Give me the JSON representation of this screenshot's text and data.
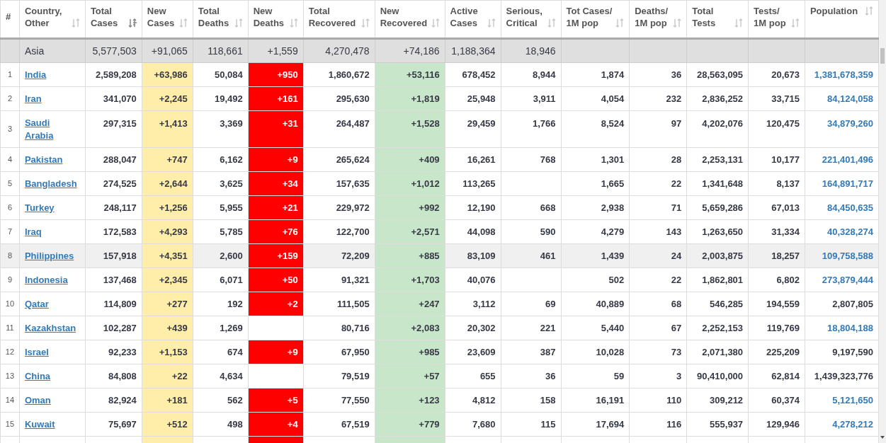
{
  "columns": [
    {
      "label": "#",
      "kind": "index"
    },
    {
      "label": "Country,\nOther",
      "kind": "country",
      "sorted": false
    },
    {
      "label": "Total\nCases",
      "kind": "plain",
      "sorted": true
    },
    {
      "label": "New\nCases",
      "kind": "new_cases",
      "sorted": false
    },
    {
      "label": "Total\nDeaths",
      "kind": "plain",
      "sorted": false
    },
    {
      "label": "New\nDeaths",
      "kind": "new_deaths",
      "sorted": false
    },
    {
      "label": "Total\nRecovered",
      "kind": "plain",
      "sorted": false
    },
    {
      "label": "New\nRecovered",
      "kind": "new_recovered",
      "sorted": false
    },
    {
      "label": "Active\nCases",
      "kind": "plain",
      "sorted": false
    },
    {
      "label": "Serious,\nCritical",
      "kind": "plain",
      "sorted": false
    },
    {
      "label": "Tot Cases/\n1M pop",
      "kind": "plain",
      "sorted": false
    },
    {
      "label": "Deaths/\n1M pop",
      "kind": "plain",
      "sorted": false
    },
    {
      "label": "Total\nTests",
      "kind": "plain",
      "sorted": false
    },
    {
      "label": "Tests/\n1M pop",
      "kind": "plain",
      "sorted": false
    },
    {
      "label": "Population",
      "kind": "population",
      "sorted": false
    }
  ],
  "total_row": {
    "country": "Asia",
    "total_cases": "5,577,503",
    "new_cases": "+91,065",
    "total_deaths": "118,661",
    "new_deaths": "+1,559",
    "total_recovered": "4,270,478",
    "new_recovered": "+74,186",
    "active_cases": "1,188,364",
    "serious_critical": "18,946"
  },
  "rows": [
    {
      "num": "1",
      "country": "India",
      "highlighted": false,
      "population_link": true,
      "total_cases": "2,589,208",
      "new_cases": "+63,986",
      "total_deaths": "50,084",
      "new_deaths": "+950",
      "total_recovered": "1,860,672",
      "new_recovered": "+53,116",
      "active_cases": "678,452",
      "serious_critical": "8,944",
      "cases_per_1m": "1,874",
      "deaths_per_1m": "36",
      "total_tests": "28,563,095",
      "tests_per_1m": "20,673",
      "population": "1,381,678,359"
    },
    {
      "num": "2",
      "country": "Iran",
      "highlighted": false,
      "population_link": true,
      "total_cases": "341,070",
      "new_cases": "+2,245",
      "total_deaths": "19,492",
      "new_deaths": "+161",
      "total_recovered": "295,630",
      "new_recovered": "+1,819",
      "active_cases": "25,948",
      "serious_critical": "3,911",
      "cases_per_1m": "4,054",
      "deaths_per_1m": "232",
      "total_tests": "2,836,252",
      "tests_per_1m": "33,715",
      "population": "84,124,058"
    },
    {
      "num": "3",
      "country": "Saudi Arabia",
      "highlighted": false,
      "population_link": true,
      "total_cases": "297,315",
      "new_cases": "+1,413",
      "total_deaths": "3,369",
      "new_deaths": "+31",
      "total_recovered": "264,487",
      "new_recovered": "+1,528",
      "active_cases": "29,459",
      "serious_critical": "1,766",
      "cases_per_1m": "8,524",
      "deaths_per_1m": "97",
      "total_tests": "4,202,076",
      "tests_per_1m": "120,475",
      "population": "34,879,260"
    },
    {
      "num": "4",
      "country": "Pakistan",
      "highlighted": false,
      "population_link": true,
      "total_cases": "288,047",
      "new_cases": "+747",
      "total_deaths": "6,162",
      "new_deaths": "+9",
      "total_recovered": "265,624",
      "new_recovered": "+409",
      "active_cases": "16,261",
      "serious_critical": "768",
      "cases_per_1m": "1,301",
      "deaths_per_1m": "28",
      "total_tests": "2,253,131",
      "tests_per_1m": "10,177",
      "population": "221,401,496"
    },
    {
      "num": "5",
      "country": "Bangladesh",
      "highlighted": false,
      "population_link": true,
      "total_cases": "274,525",
      "new_cases": "+2,644",
      "total_deaths": "3,625",
      "new_deaths": "+34",
      "total_recovered": "157,635",
      "new_recovered": "+1,012",
      "active_cases": "113,265",
      "cases_per_1m": "1,665",
      "deaths_per_1m": "22",
      "total_tests": "1,341,648",
      "tests_per_1m": "8,137",
      "population": "164,891,717"
    },
    {
      "num": "6",
      "country": "Turkey",
      "highlighted": false,
      "population_link": true,
      "total_cases": "248,117",
      "new_cases": "+1,256",
      "total_deaths": "5,955",
      "new_deaths": "+21",
      "total_recovered": "229,972",
      "new_recovered": "+992",
      "active_cases": "12,190",
      "serious_critical": "668",
      "cases_per_1m": "2,938",
      "deaths_per_1m": "71",
      "total_tests": "5,659,286",
      "tests_per_1m": "67,013",
      "population": "84,450,635"
    },
    {
      "num": "7",
      "country": "Iraq",
      "highlighted": false,
      "population_link": true,
      "total_cases": "172,583",
      "new_cases": "+4,293",
      "total_deaths": "5,785",
      "new_deaths": "+76",
      "total_recovered": "122,700",
      "new_recovered": "+2,571",
      "active_cases": "44,098",
      "serious_critical": "590",
      "cases_per_1m": "4,279",
      "deaths_per_1m": "143",
      "total_tests": "1,263,650",
      "tests_per_1m": "31,334",
      "population": "40,328,274"
    },
    {
      "num": "8",
      "country": "Philippines",
      "highlighted": true,
      "population_link": true,
      "total_cases": "157,918",
      "new_cases": "+4,351",
      "total_deaths": "2,600",
      "new_deaths": "+159",
      "total_recovered": "72,209",
      "new_recovered": "+885",
      "active_cases": "83,109",
      "serious_critical": "461",
      "cases_per_1m": "1,439",
      "deaths_per_1m": "24",
      "total_tests": "2,003,875",
      "tests_per_1m": "18,257",
      "population": "109,758,588"
    },
    {
      "num": "9",
      "country": "Indonesia",
      "highlighted": false,
      "population_link": true,
      "total_cases": "137,468",
      "new_cases": "+2,345",
      "total_deaths": "6,071",
      "new_deaths": "+50",
      "total_recovered": "91,321",
      "new_recovered": "+1,703",
      "active_cases": "40,076",
      "cases_per_1m": "502",
      "deaths_per_1m": "22",
      "total_tests": "1,862,801",
      "tests_per_1m": "6,802",
      "population": "273,879,444"
    },
    {
      "num": "10",
      "country": "Qatar",
      "highlighted": false,
      "population_link": false,
      "total_cases": "114,809",
      "new_cases": "+277",
      "total_deaths": "192",
      "new_deaths": "+2",
      "total_recovered": "111,505",
      "new_recovered": "+247",
      "active_cases": "3,112",
      "serious_critical": "69",
      "cases_per_1m": "40,889",
      "deaths_per_1m": "68",
      "total_tests": "546,285",
      "tests_per_1m": "194,559",
      "population": "2,807,805"
    },
    {
      "num": "11",
      "country": "Kazakhstan",
      "highlighted": false,
      "population_link": true,
      "total_cases": "102,287",
      "new_cases": "+439",
      "total_deaths": "1,269",
      "total_recovered": "80,716",
      "new_recovered": "+2,083",
      "active_cases": "20,302",
      "serious_critical": "221",
      "cases_per_1m": "5,440",
      "deaths_per_1m": "67",
      "total_tests": "2,252,153",
      "tests_per_1m": "119,769",
      "population": "18,804,188"
    },
    {
      "num": "12",
      "country": "Israel",
      "highlighted": false,
      "population_link": false,
      "total_cases": "92,233",
      "new_cases": "+1,153",
      "total_deaths": "674",
      "new_deaths": "+9",
      "total_recovered": "67,950",
      "new_recovered": "+985",
      "active_cases": "23,609",
      "serious_critical": "387",
      "cases_per_1m": "10,028",
      "deaths_per_1m": "73",
      "total_tests": "2,071,380",
      "tests_per_1m": "225,209",
      "population": "9,197,590"
    },
    {
      "num": "13",
      "country": "China",
      "highlighted": false,
      "population_link": false,
      "total_cases": "84,808",
      "new_cases": "+22",
      "total_deaths": "4,634",
      "total_recovered": "79,519",
      "new_recovered": "+57",
      "active_cases": "655",
      "serious_critical": "36",
      "cases_per_1m": "59",
      "deaths_per_1m": "3",
      "total_tests": "90,410,000",
      "tests_per_1m": "62,814",
      "population": "1,439,323,776"
    },
    {
      "num": "14",
      "country": "Oman",
      "highlighted": false,
      "population_link": true,
      "total_cases": "82,924",
      "new_cases": "+181",
      "total_deaths": "562",
      "new_deaths": "+5",
      "total_recovered": "77,550",
      "new_recovered": "+123",
      "active_cases": "4,812",
      "serious_critical": "158",
      "cases_per_1m": "16,191",
      "deaths_per_1m": "110",
      "total_tests": "309,212",
      "tests_per_1m": "60,374",
      "population": "5,121,650"
    },
    {
      "num": "15",
      "country": "Kuwait",
      "highlighted": false,
      "population_link": true,
      "total_cases": "75,697",
      "new_cases": "+512",
      "total_deaths": "498",
      "new_deaths": "+4",
      "total_recovered": "67,519",
      "new_recovered": "+779",
      "active_cases": "7,680",
      "serious_critical": "115",
      "cases_per_1m": "17,694",
      "deaths_per_1m": "116",
      "total_tests": "555,937",
      "tests_per_1m": "129,946",
      "population": "4,278,212"
    }
  ]
}
